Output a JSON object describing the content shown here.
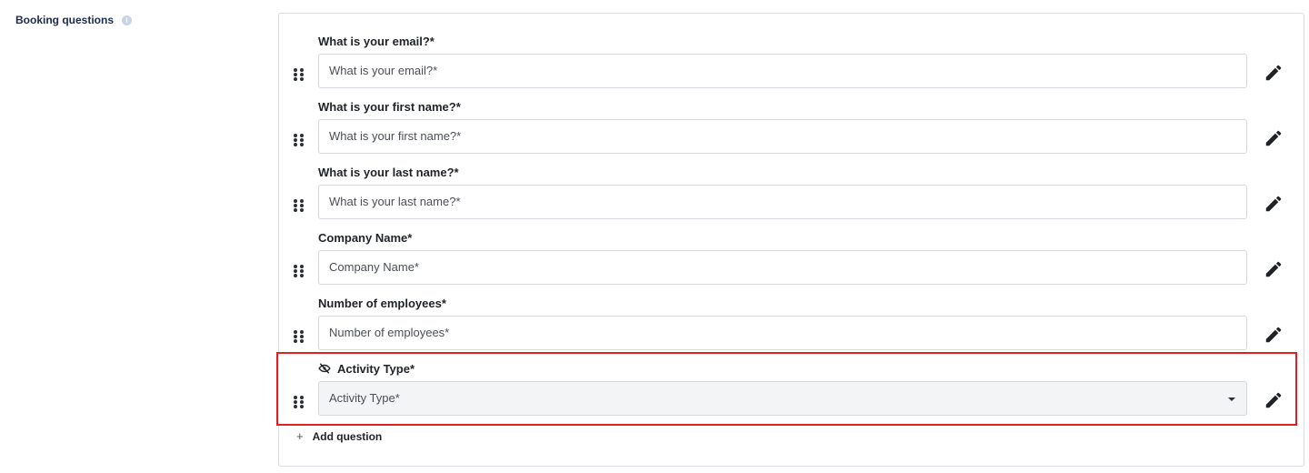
{
  "section": {
    "label": "Booking questions",
    "info_icon": "i"
  },
  "questions": [
    {
      "label": "What is your email?*",
      "placeholder": "What is your email?*",
      "type": "text"
    },
    {
      "label": "What is your first name?*",
      "placeholder": "What is your first name?*",
      "type": "text"
    },
    {
      "label": "What is your last name?*",
      "placeholder": "What is your last name?*",
      "type": "text"
    },
    {
      "label": "Company Name*",
      "placeholder": "Company Name*",
      "type": "text"
    },
    {
      "label": "Number of employees*",
      "placeholder": "Number of employees*",
      "type": "text"
    },
    {
      "label": "Activity Type*",
      "placeholder": "Activity Type*",
      "type": "select",
      "hidden": true
    }
  ],
  "add_question": {
    "icon": "+",
    "label": "Add question"
  },
  "colors": {
    "highlight": "#e01f1f",
    "section_label": "#1b2a4e"
  }
}
